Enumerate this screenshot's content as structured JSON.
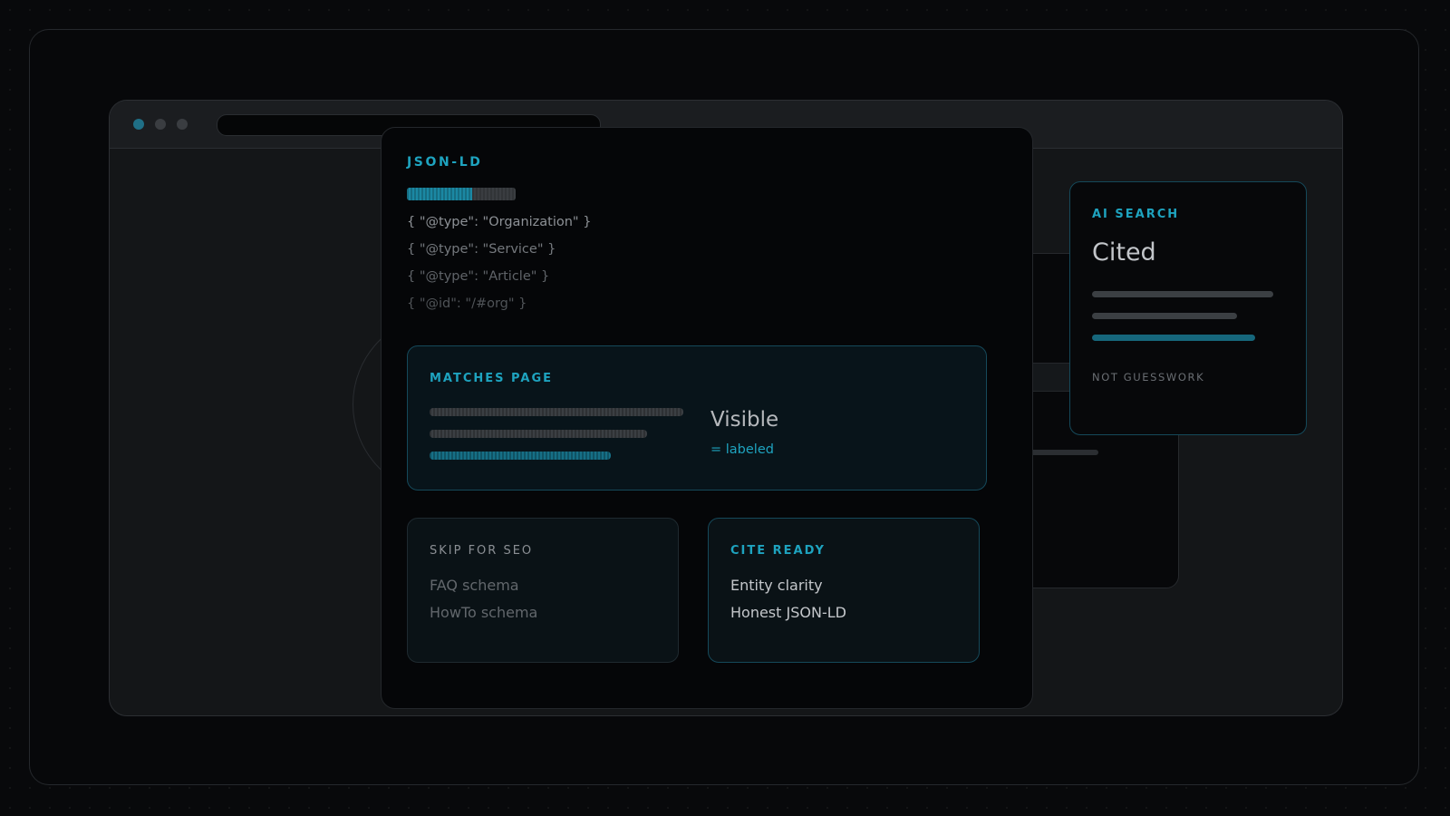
{
  "main": {
    "title": "JSON-LD",
    "progress_fraction": 0.6,
    "code_lines": [
      "{ \"@type\": \"Organization\" }",
      "{ \"@type\": \"Service\" }",
      "{ \"@type\": \"Article\" }",
      "{ \"@id\": \"/#org\" }"
    ]
  },
  "matches": {
    "label": "MATCHES PAGE",
    "title": "Visible",
    "subtitle": "= labeled"
  },
  "skip_card": {
    "label": "SKIP FOR SEO",
    "items": [
      "FAQ schema",
      "HowTo schema"
    ]
  },
  "cite_card": {
    "label": "CITE READY",
    "items": [
      "Entity clarity",
      "Honest JSON-LD"
    ]
  },
  "ai_card": {
    "label": "AI SEARCH",
    "title": "Cited",
    "footer": "NOT GUESSWORK"
  },
  "colors": {
    "accent": "#1ea3bf",
    "background": "#08090b"
  }
}
